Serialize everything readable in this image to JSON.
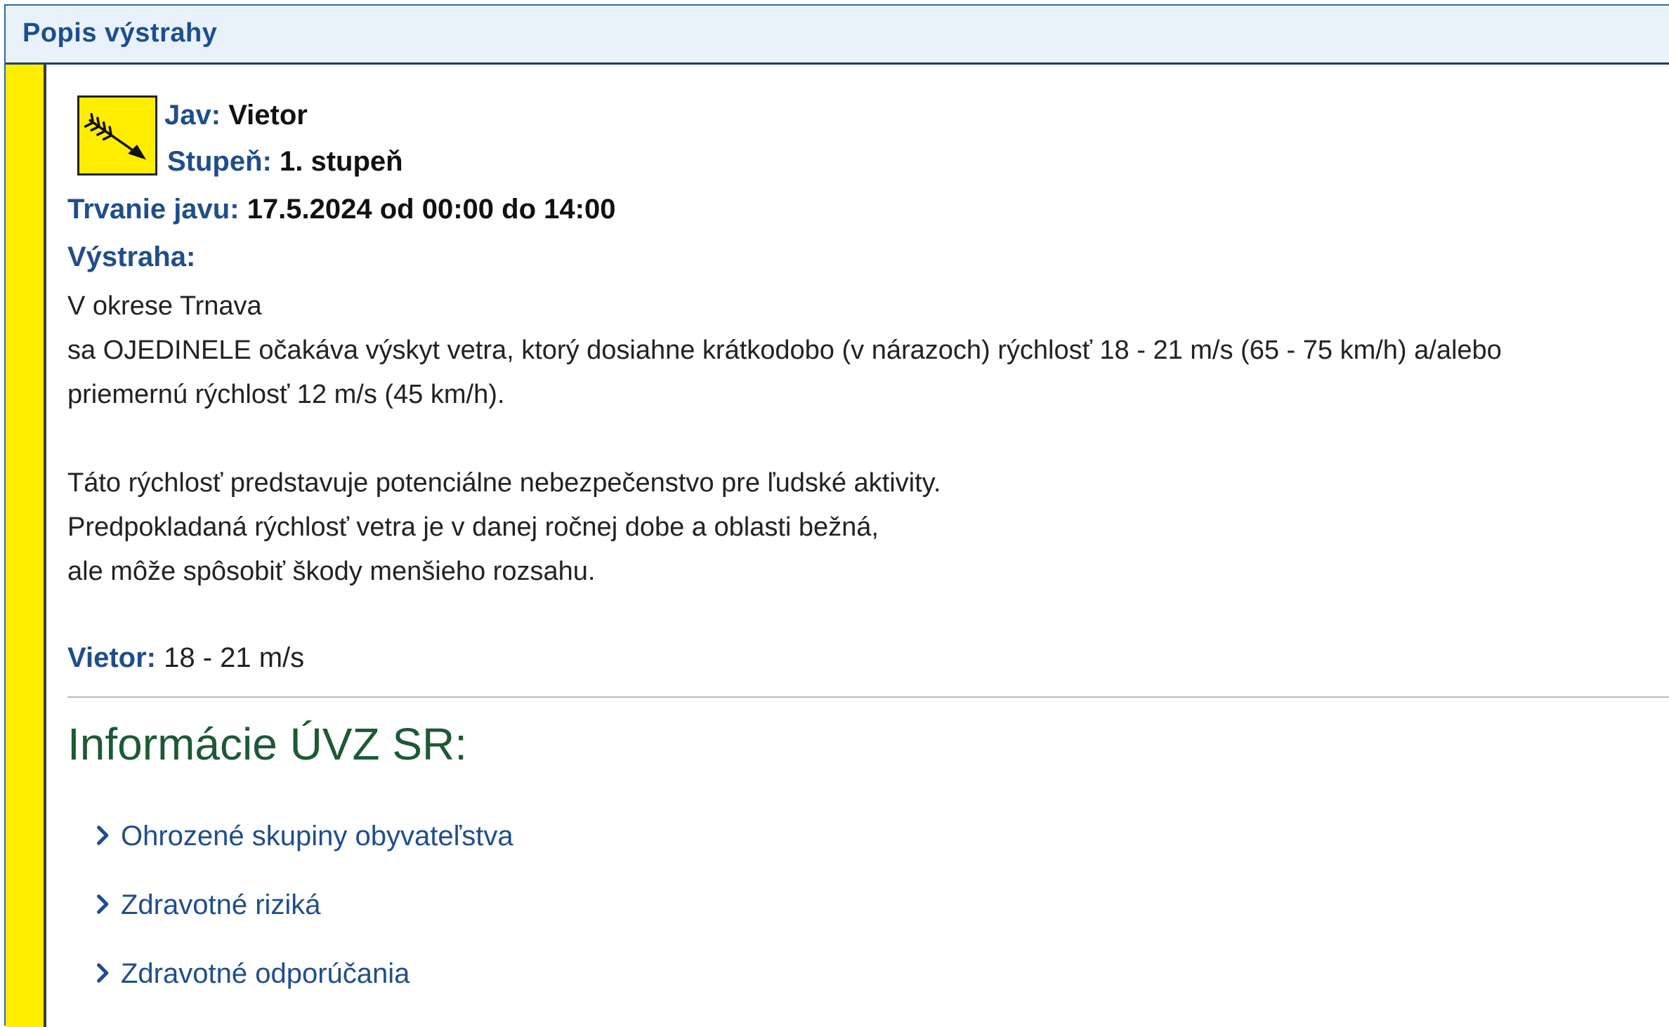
{
  "header": {
    "title": "Popis výstrahy"
  },
  "colors": {
    "warning_level": "#ffed00",
    "label_blue": "#1f4e8c",
    "heading_green": "#1c5a34"
  },
  "phenomenon": {
    "icon": "wind-icon",
    "jav_label": "Jav:",
    "jav_value": "Vietor",
    "stupen_label": "Stupeň:",
    "stupen_value": "1. stupeň"
  },
  "duration": {
    "label": "Trvanie javu:",
    "value": "17.5.2024 od 00:00 do 14:00"
  },
  "warning": {
    "label": "Výstraha:",
    "lines": [
      "V okrese Trnava",
      "sa OJEDINELE očakáva výskyt vetra, ktorý dosiahne krátkodobo (v nárazoch) rýchlosť 18 - 21 m/s (65 - 75 km/h) a/alebo",
      "priemernú rýchlosť 12 m/s (45 km/h).",
      "Táto rýchlosť predstavuje potenciálne nebezpečenstvo pre ľudské aktivity.",
      "Predpokladaná rýchlosť vetra je v danej ročnej dobe a oblasti bežná,",
      "ale môže spôsobiť škody menšieho rozsahu."
    ]
  },
  "wind": {
    "label": "Vietor:",
    "value": "18 - 21 m/s"
  },
  "info": {
    "heading": "Informácie ÚVZ SR:",
    "links": [
      {
        "label": "Ohrozené skupiny obyvateľstva",
        "icon": "chevron-right-icon"
      },
      {
        "label": "Zdravotné riziká",
        "icon": "chevron-right-icon"
      },
      {
        "label": "Zdravotné odporúčania",
        "icon": "chevron-right-icon"
      }
    ]
  }
}
